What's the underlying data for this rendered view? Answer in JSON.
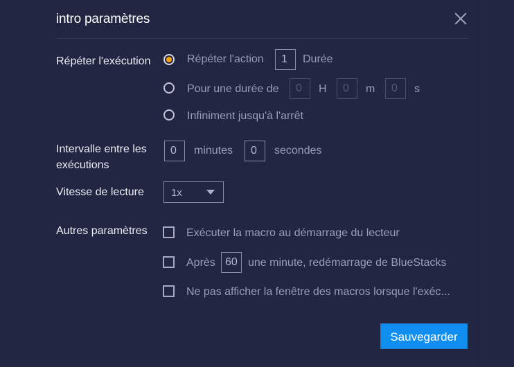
{
  "dialog": {
    "title": "intro paramètres",
    "close_icon": "close-icon"
  },
  "repeat": {
    "label": "Répéter l'exécution",
    "options": [
      {
        "label": "Répéter l'action",
        "selected": true,
        "count": "1",
        "suffix": "Durée"
      },
      {
        "label": "Pour une durée de",
        "selected": false,
        "hours": "0",
        "hours_unit": "H",
        "minutes": "0",
        "minutes_unit": "m",
        "seconds": "0",
        "seconds_unit": "s"
      },
      {
        "label": "Infiniment jusqu'à l'arrêt",
        "selected": false
      }
    ]
  },
  "interval": {
    "label_line1": "Intervalle entre les",
    "label_line2": "exécutions",
    "minutes": "0",
    "minutes_label": "minutes",
    "seconds": "0",
    "seconds_label": "secondes"
  },
  "speed": {
    "label": "Vitesse de lecture",
    "selected": "1x"
  },
  "other": {
    "label": "Autres paramètres",
    "options": [
      {
        "label": "Exécuter la macro au démarrage du lecteur",
        "checked": false
      },
      {
        "label_before": "Après",
        "value": "60",
        "label_after": "une minute, redémarrage de BlueStacks",
        "checked": false
      },
      {
        "label": "Ne pas afficher la fenêtre des macros lorsque l'exéc...",
        "checked": false
      }
    ]
  },
  "footer": {
    "save_label": "Sauvegarder"
  },
  "colors": {
    "background": "#222643",
    "accent_radio": "#f7a20c",
    "primary_button": "#0f8ef0"
  }
}
